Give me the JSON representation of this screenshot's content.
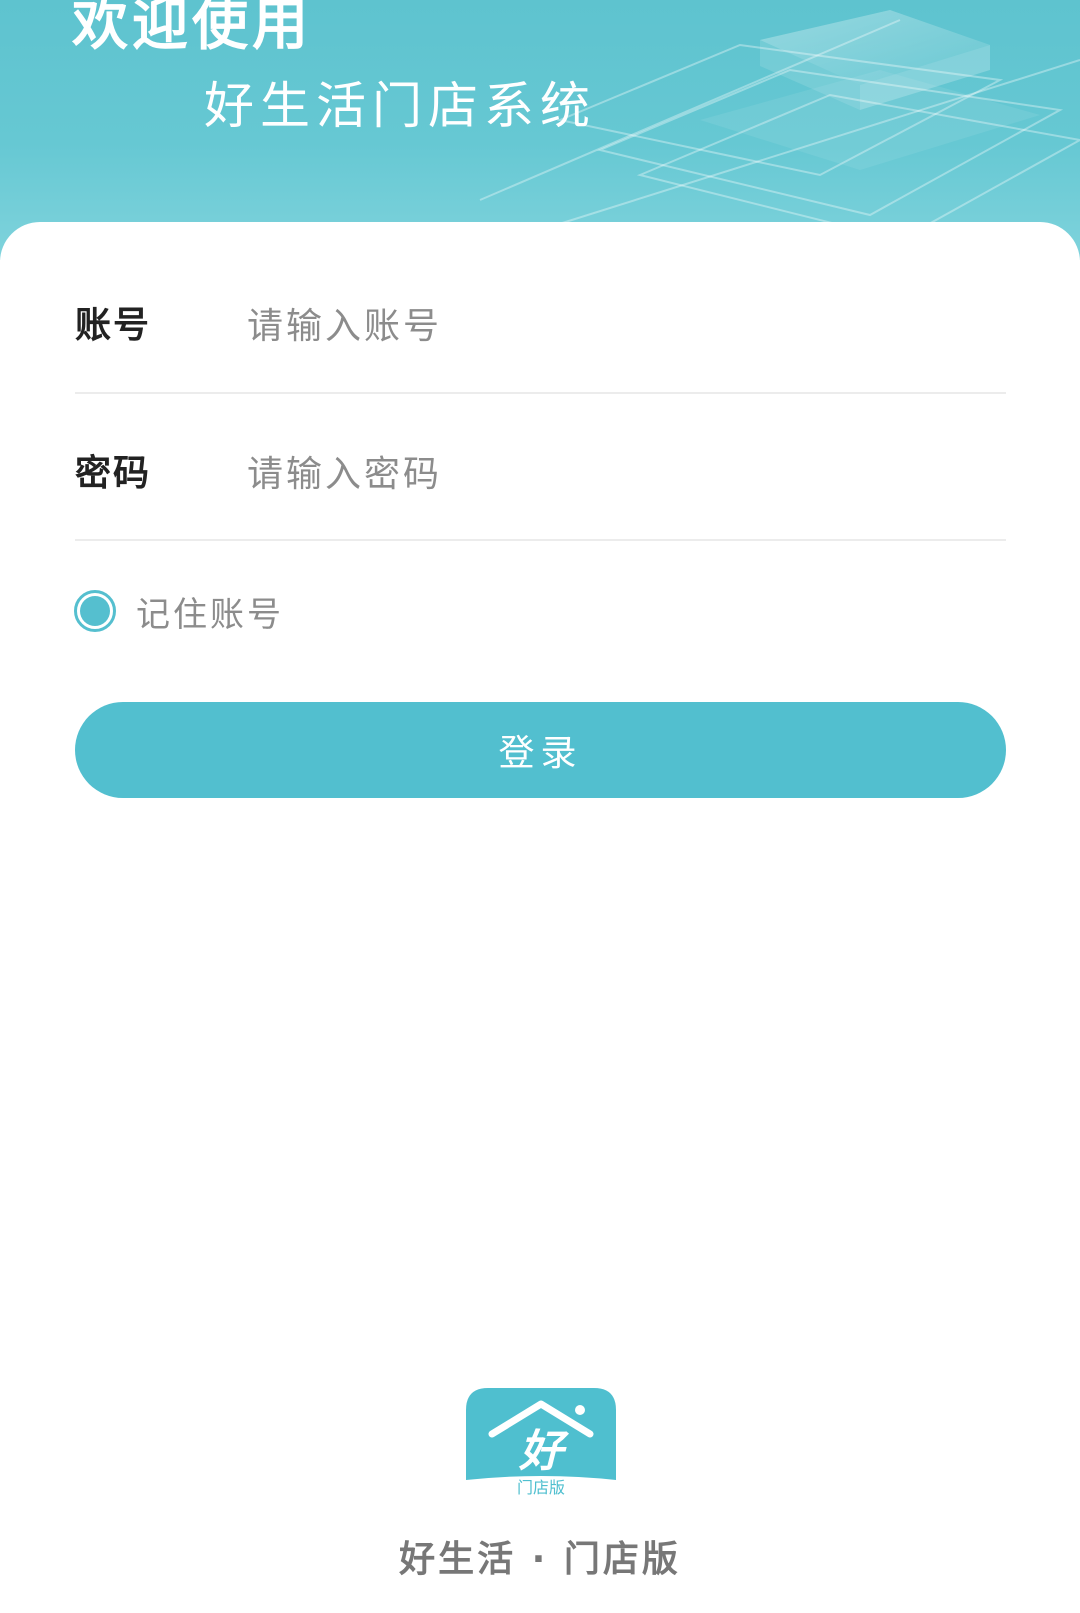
{
  "header": {
    "title_line1": "欢迎使用",
    "title_line2": "好生活门店系统"
  },
  "form": {
    "account": {
      "label": "账号",
      "placeholder": "请输入账号",
      "value": ""
    },
    "password": {
      "label": "密码",
      "placeholder": "请输入密码",
      "value": ""
    },
    "remember": {
      "label": "记住账号",
      "checked": true
    },
    "login_button": "登录"
  },
  "footer": {
    "logo_glyph": "好",
    "logo_caption": "门店版",
    "app_name": "好生活 · 门店版"
  },
  "colors": {
    "accent": "#52bfcf",
    "header_bg": "#66c8d3",
    "label_text": "#222222",
    "placeholder_text": "#8c8c8c",
    "footer_text": "#777777"
  },
  "icons": {
    "remember_radio": "radio-checked-icon",
    "logo": "house-logo-icon"
  }
}
